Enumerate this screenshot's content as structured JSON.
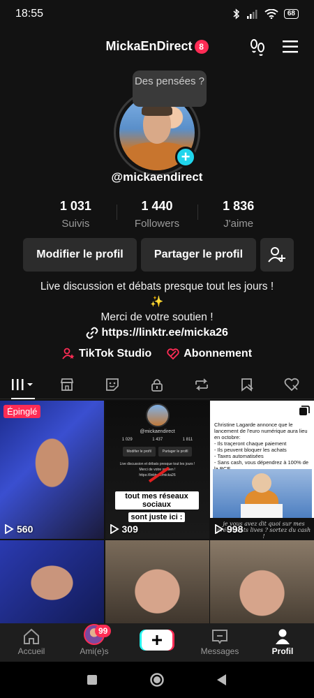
{
  "status_bar": {
    "time": "18:55",
    "battery": "68"
  },
  "header": {
    "username_title": "MickaEnDirect",
    "notification_count": "8"
  },
  "profile": {
    "thought_bubble": "Des pensées ?",
    "handle": "@mickaendirect",
    "stats": [
      {
        "value": "1 031",
        "label": "Suivis"
      },
      {
        "value": "1 440",
        "label": "Followers"
      },
      {
        "value": "1 836",
        "label": "J'aime"
      }
    ],
    "edit_label": "Modifier le profil",
    "share_label": "Partager le profil",
    "bio_line1": "Live discussion et débats presque tout les jours !",
    "bio_sparkle": "✨",
    "bio_line2": "Merci de votre soutien !",
    "link": "https://linktr.ee/micka26",
    "studio_label": "TikTok Studio",
    "subscription_label": "Abonnement"
  },
  "videos": [
    {
      "views": "560",
      "pinned_label": "Épinglé"
    },
    {
      "views": "309",
      "caption_line1": "tout mes réseaux sociaux",
      "caption_line2": "sont juste ici :",
      "mini_handle": "@mickaendirect",
      "mini_stats": [
        "1 029",
        "1 437",
        "1 811"
      ],
      "mini_edit": "Modifier le profil",
      "mini_share": "Partager le profil",
      "mini_bio1": "Live discussion et débats presque tout les jours !",
      "mini_bio2": "Merci de votre soutien !",
      "mini_link": "https://linktr.ee/micka26"
    },
    {
      "views": "998",
      "news_title": "Christine Lagarde annonce que le lancement de l'euro numérique aura lieu en octobre:",
      "news_points": [
        "- Ils traçeront chaque paiement",
        "- Ils peuvent bloquer les achats",
        "- Taxes automatisées",
        "- Sans cash, vous dépendrez à 100% de la BCE"
      ],
      "news_quote": "je vous avez dit quoi sur mes précédents lives ? sortez du cash !"
    },
    {},
    {},
    {}
  ],
  "bottom_nav": [
    {
      "label": "Accueil"
    },
    {
      "label": "Ami(e)s",
      "badge": "99"
    },
    {
      "label": ""
    },
    {
      "label": "Messages"
    },
    {
      "label": "Profil"
    }
  ]
}
